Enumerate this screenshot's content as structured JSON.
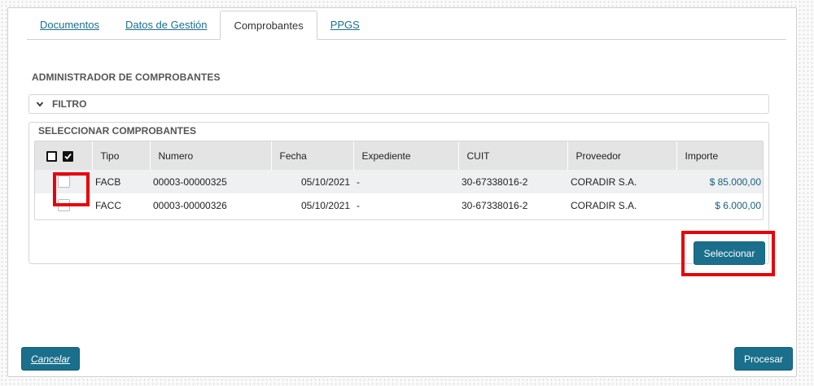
{
  "tabs": [
    {
      "label": "Documentos",
      "active": false
    },
    {
      "label": "Datos de Gestión",
      "active": false
    },
    {
      "label": "Comprobantes",
      "active": true
    },
    {
      "label": "PPGS",
      "active": false
    }
  ],
  "main": {
    "title": "ADMINISTRADOR DE COMPROBANTES",
    "filter_label": "FILTRO",
    "select_section_title": "SELECCIONAR COMPROBANTES"
  },
  "table": {
    "columns": [
      "Tipo",
      "Numero",
      "Fecha",
      "Expediente",
      "CUIT",
      "Proveedor",
      "Importe"
    ],
    "rows": [
      {
        "tipo": "FACB",
        "numero": "00003-00000325",
        "fecha": "05/10/2021",
        "expediente": "-",
        "cuit": "30-67338016-2",
        "proveedor": "CORADIR S.A.",
        "importe": "$ 85.000,00",
        "checked": false
      },
      {
        "tipo": "FACC",
        "numero": "00003-00000326",
        "fecha": "05/10/2021",
        "expediente": "-",
        "cuit": "30-67338016-2",
        "proveedor": "CORADIR S.A.",
        "importe": "$ 6.000,00",
        "checked": false
      }
    ]
  },
  "buttons": {
    "select": "Seleccionar",
    "cancel": "Cancelar",
    "process": "Procesar"
  },
  "colors": {
    "accent": "#1a6f8c",
    "highlight": "#e8000a",
    "header_bg": "#e4e4e4",
    "row_stripe": "#eef0f2"
  },
  "icons": {
    "filter_toggle": "chevron-down-icon",
    "select_none": "unchecked-box-icon",
    "select_all": "checked-box-icon"
  }
}
